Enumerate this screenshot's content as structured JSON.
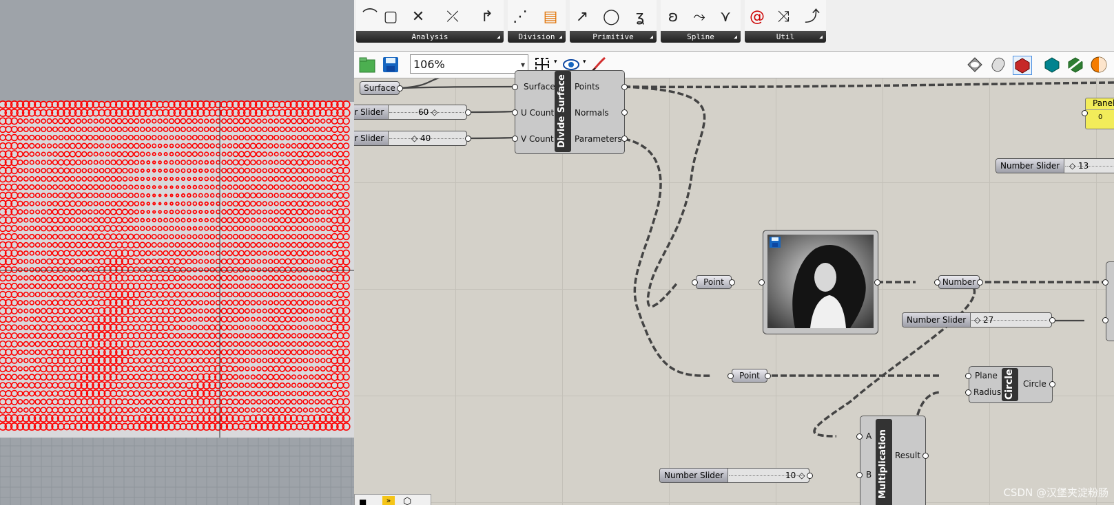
{
  "ribbon": {
    "groups": [
      {
        "name": "Analysis"
      },
      {
        "name": "Division"
      },
      {
        "name": "Primitive"
      },
      {
        "name": "Spline"
      },
      {
        "name": "Util"
      }
    ]
  },
  "toolbar": {
    "zoom": "106%"
  },
  "components": {
    "surface_param": "Surface",
    "divide_surface": {
      "title": "Divide Surface",
      "inputs": [
        "Surface",
        "U Count",
        "V Count"
      ],
      "outputs": [
        "Points",
        "Normals",
        "Parameters"
      ]
    },
    "point_1": "Point",
    "point_2": "Point",
    "number_param": "Number",
    "circle": {
      "title": "Circle",
      "inputs": [
        "Plane",
        "Radius"
      ],
      "output": "Circle"
    },
    "multiplication": {
      "title": "Multiplication",
      "inputs": [
        "A",
        "B"
      ],
      "output": "Result"
    },
    "panel": {
      "title": "Panel",
      "value": "0"
    }
  },
  "sliders": {
    "u_count": {
      "name": "er Slider",
      "value": "60"
    },
    "v_count": {
      "name": "er Slider",
      "value": "40"
    },
    "slider_13": {
      "name": "Number Slider",
      "value": "13"
    },
    "slider_27": {
      "name": "Number Slider",
      "value": "27"
    },
    "slider_10": {
      "name": "Number Slider",
      "value": "10"
    }
  },
  "watermark": "CSDN @汉堡夹淀粉肠",
  "colors": {
    "pattern": "#ff0000",
    "viewport_bg": "#9ea3a9",
    "canvas_bg": "#d4d1c9",
    "panel_yellow": "#f2ec5a"
  }
}
